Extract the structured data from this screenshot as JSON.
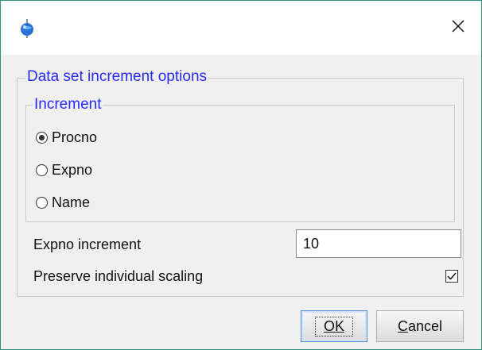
{
  "window": {
    "icon": "app-globe-icon",
    "close_icon": "close-icon",
    "close_glyph": "✕"
  },
  "outer_group": {
    "title": "Data set increment options"
  },
  "increment_group": {
    "title": "Increment",
    "options": [
      {
        "label": "Procno",
        "checked": true
      },
      {
        "label": "Expno",
        "checked": false
      },
      {
        "label": "Name",
        "checked": false
      }
    ]
  },
  "expno_increment": {
    "label": "Expno increment",
    "value": "10"
  },
  "preserve_scaling": {
    "label": "Preserve individual scaling",
    "checked": true
  },
  "buttons": {
    "ok": {
      "mnemonic": "O",
      "rest": "K"
    },
    "cancel": {
      "mnemonic": "C",
      "rest": "ancel"
    }
  },
  "colors": {
    "group_title": "#2a2aff",
    "window_border": "#2f8f7f",
    "background": "#f0f0f0"
  }
}
